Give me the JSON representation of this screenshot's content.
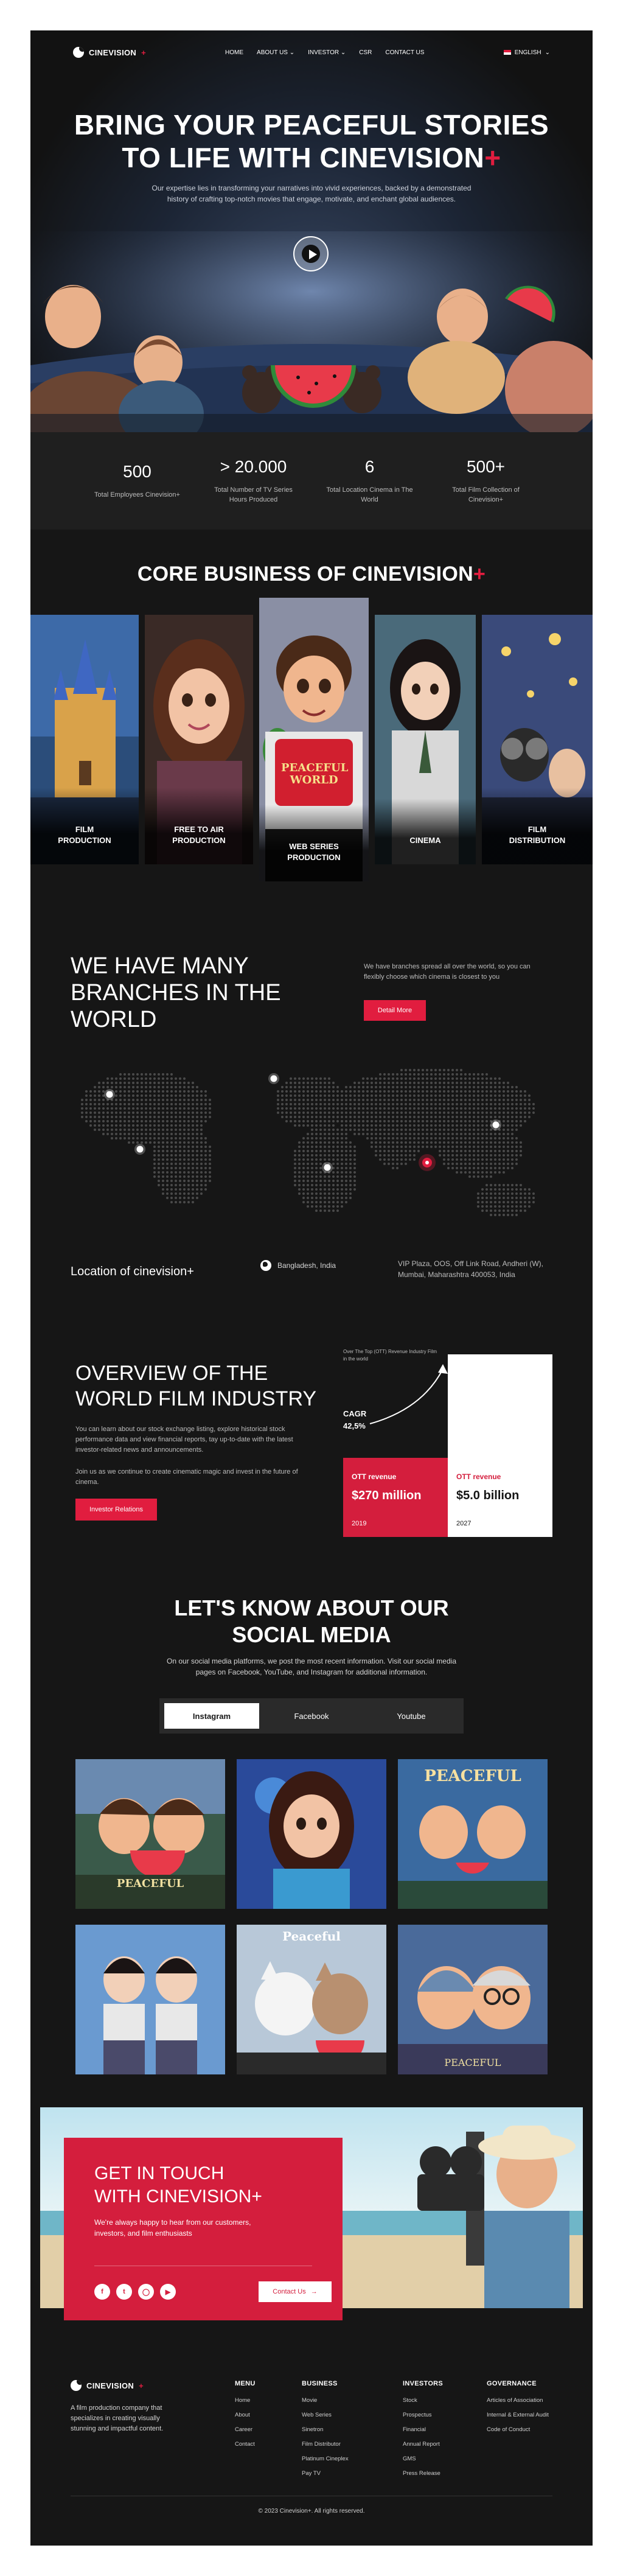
{
  "nav": {
    "brand": "CINEVISION",
    "brand_plus": "+",
    "items": [
      "HOME",
      "ABOUT US",
      "INVESTOR",
      "CSR",
      "CONTACT US"
    ],
    "language": "ENGLISH"
  },
  "hero": {
    "title_line1": "BRING YOUR  PEACEFUL STORIES",
    "title_line2": "TO LIFE WITH CINEVISION",
    "title_plus": "+",
    "subtitle": "Our expertise lies in transforming your narratives into vivid experiences, backed by a demonstrated history of crafting top-notch movies that engage, motivate, and enchant global audiences."
  },
  "stats": [
    {
      "value": "500",
      "label": "Total Employees Cinevision+"
    },
    {
      "value": "> 20.000",
      "label": "Total Number of TV Series Hours Produced"
    },
    {
      "value": "6",
      "label": "Total Location Cinema in The World"
    },
    {
      "value": "500+",
      "label": "Total Film Collection of Cinevision+"
    }
  ],
  "core": {
    "title": "CORE BUSINESS OF CINEVISION",
    "title_plus": "+",
    "cards": [
      {
        "line1": "FILM",
        "line2": "PRODUCTION"
      },
      {
        "line1": "FREE TO AIR",
        "line2": "PRODUCTION"
      },
      {
        "line1": "WEB SERIES",
        "line2": "PRODUCTION"
      },
      {
        "line1": "CINEMA",
        "line2": ""
      },
      {
        "line1": "FILM",
        "line2": "DISTRIBUTION"
      }
    ],
    "poster_text_1": "PEACEFUL",
    "poster_text_2": "WORLD"
  },
  "branches": {
    "title": "WE HAVE MANY BRANCHES IN THE WORLD",
    "description": "We have branches spread all over the world, so you can flexibly choose which cinema is closest to you",
    "button": "Detail More",
    "location_title": "Location of cinevision+",
    "location_place": "Bangladesh, India",
    "address": "VIP Plaza, OOS, Off Link Road, Andheri (W), Mumbai, Maharashtra 400053, India"
  },
  "overview": {
    "title": "OVERVIEW OF THE WORLD FILM INDUSTRY",
    "para1": "You can learn about our stock exchange listing, explore historical stock performance data and view financial reports, tay up-to-date with the latest investor-related news and announcements.",
    "para2": "Join us as we continue to create cinematic magic and invest in the future of cinema.",
    "button": "Investor Relations",
    "chart_data": {
      "type": "bar",
      "title": "Over The Top (OTT) Revenue Industry Film in the world",
      "categories": [
        "2019",
        "2027"
      ],
      "values": [
        270,
        5000
      ],
      "value_labels": [
        "$270 million",
        "$5.0 billion"
      ],
      "series_label": "OTT revenue",
      "cagr_label": "CAGR",
      "cagr_value": "42,5%"
    }
  },
  "social": {
    "title_line1": "LET'S KNOW ABOUT OUR",
    "title_line2": "SOCIAL MEDIA",
    "description": "On our social media platforms, we post the most recent information. Visit our social media pages on Facebook, YouTube, and Instagram for additional information.",
    "tabs": [
      "Instagram",
      "Facebook",
      "Youtube"
    ],
    "active_tab": "Instagram",
    "poster_texts": [
      "PEACEFUL",
      "PEACEFUL",
      "Peaceful",
      "PEACEFUL"
    ]
  },
  "contact": {
    "title_line1": "GET IN TOUCH",
    "title_line2": "WITH CINEVISION+",
    "text": "We're always happy to hear from our customers, investors, and film enthusiasts",
    "button": "Contact Us",
    "social_icons": [
      "facebook-icon",
      "twitter-icon",
      "instagram-icon",
      "youtube-icon"
    ]
  },
  "footer": {
    "brand": "CINEVISION",
    "brand_plus": "+",
    "description": "A film production company that specializes in creating visually stunning and impactful content.",
    "columns": [
      {
        "title": "MENU",
        "items": [
          "Home",
          "About",
          "Career",
          "Contact"
        ]
      },
      {
        "title": "BUSINESS",
        "items": [
          "Movie",
          "Web Series",
          "Sinetron",
          "Film Distributor",
          "Platinum Cineplex",
          "Pay TV"
        ]
      },
      {
        "title": "INVESTORS",
        "items": [
          "Stock",
          "Prospectus",
          "Financial",
          "Annual Report",
          "GMS",
          "Press Release"
        ]
      },
      {
        "title": "GOVERNANCE",
        "items": [
          "Articles of Association",
          "Internal & External Audit",
          "Code of Conduct"
        ]
      }
    ],
    "copyright": "© 2023 Cinevision+. All rights reserved."
  },
  "colors": {
    "accent": "#e11d3f",
    "background": "#161616",
    "surface": "#1f1f1f"
  }
}
